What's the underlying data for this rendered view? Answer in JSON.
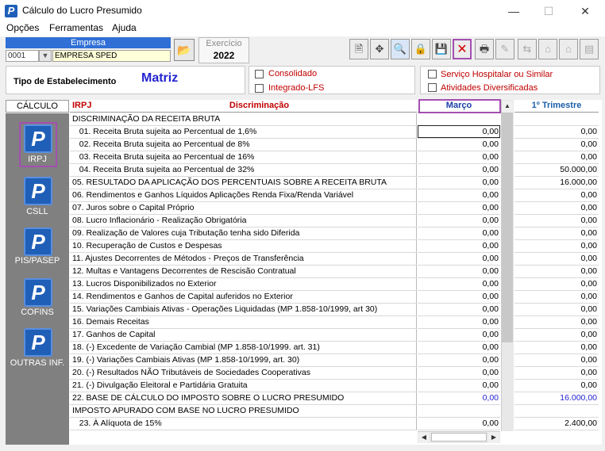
{
  "window": {
    "title": "Cálculo do Lucro Presumido",
    "controls": [
      "—",
      "☐",
      "✕"
    ]
  },
  "menu": [
    "Opções",
    "Ferramentas",
    "Ajuda"
  ],
  "empresa": {
    "header": "Empresa",
    "code": "0001",
    "name": "EMPRESA SPED"
  },
  "exercicio": {
    "label": "Exercício",
    "value": "2022"
  },
  "estabelecimento": {
    "label": "Tipo de Estabelecimento",
    "value": "Matriz"
  },
  "options": {
    "consolidado": "Consolidado",
    "integrado": "Integrado-LFS",
    "hospitalar": "Serviço Hospitalar ou Similar",
    "diversificadas": "Atividades Diversificadas"
  },
  "left_panel": {
    "header": "CÁLCULO",
    "items": [
      "IRPJ",
      "CSLL",
      "PIS/PASEP",
      "COFINS",
      "OUTRAS INF."
    ]
  },
  "grid": {
    "col_tax": "IRPJ",
    "col_desc": "Discriminação",
    "col_month": "Março",
    "col_quarter": "1º Trimestre",
    "rows": [
      {
        "d": "DISCRIMINAÇÃO DA RECEITA BRUTA",
        "m": "",
        "q": ""
      },
      {
        "d": "   01. Receita Bruta sujeita ao Percentual de 1,6%",
        "m": "0,00",
        "q": "0,00"
      },
      {
        "d": "   02. Receita Bruta sujeita ao Percentual de 8%",
        "m": "0,00",
        "q": "0,00"
      },
      {
        "d": "   03. Receita Bruta sujeita ao Percentual de 16%",
        "m": "0,00",
        "q": "0,00"
      },
      {
        "d": "   04. Receita Bruta sujeita ao Percentual de 32%",
        "m": "0,00",
        "q": "50.000,00"
      },
      {
        "d": "05. RESULTADO DA APLICAÇÃO DOS PERCENTUAIS SOBRE A RECEITA BRUTA",
        "m": "0,00",
        "q": "16.000,00"
      },
      {
        "d": "06. Rendimentos e Ganhos Líquidos Aplicações Renda Fixa/Renda Variável",
        "m": "0,00",
        "q": "0,00"
      },
      {
        "d": "07. Juros sobre o Capital Próprio",
        "m": "0,00",
        "q": "0,00"
      },
      {
        "d": "08. Lucro Inflacionário - Realização Obrigatória",
        "m": "0,00",
        "q": "0,00"
      },
      {
        "d": "09. Realização de Valores cuja Tributação tenha sido Diferida",
        "m": "0,00",
        "q": "0,00"
      },
      {
        "d": "10. Recuperação de Custos e Despesas",
        "m": "0,00",
        "q": "0,00"
      },
      {
        "d": "11. Ajustes Decorrentes de Métodos - Preços de Transferência",
        "m": "0,00",
        "q": "0,00"
      },
      {
        "d": "12. Multas e Vantagens Decorrentes de Rescisão Contratual",
        "m": "0,00",
        "q": "0,00"
      },
      {
        "d": "13. Lucros Disponibilizados no Exterior",
        "m": "0,00",
        "q": "0,00"
      },
      {
        "d": "14. Rendimentos e Ganhos de Capital auferidos no Exterior",
        "m": "0,00",
        "q": "0,00"
      },
      {
        "d": "15. Variações Cambiais Ativas - Operações Liquidadas (MP 1.858-10/1999, art 30)",
        "m": "0,00",
        "q": "0,00"
      },
      {
        "d": "16. Demais Receitas",
        "m": "0,00",
        "q": "0,00"
      },
      {
        "d": "17. Ganhos de Capital",
        "m": "0,00",
        "q": "0,00"
      },
      {
        "d": "18. (-) Excedente de Variação Cambial (MP 1.858-10/1999. art. 31)",
        "m": "0,00",
        "q": "0,00"
      },
      {
        "d": "19. (-) Variações Cambiais Ativas (MP 1.858-10/1999, art. 30)",
        "m": "0,00",
        "q": "0,00"
      },
      {
        "d": "20. (-) Resultados NÃO Tributáveis de Sociedades Cooperativas",
        "m": "0,00",
        "q": "0,00"
      },
      {
        "d": "21. (-) Divulgação Eleitoral e Partidária Gratuita",
        "m": "0,00",
        "q": "0,00"
      },
      {
        "d": "22. BASE DE CÁLCULO DO IMPOSTO SOBRE O LUCRO PRESUMIDO",
        "m": "0,00",
        "q": "16.000,00",
        "blue": true
      },
      {
        "d": "IMPOSTO APURADO COM BASE NO LUCRO PRESUMIDO",
        "m": "",
        "q": ""
      },
      {
        "d": "   23. À Alíquota de 15%",
        "m": "0,00",
        "q": "2.400,00"
      }
    ]
  },
  "colors": {
    "accent": "#2f6fd6",
    "highlight": "#a34fb0",
    "red_label": "#c00000",
    "blue_value": "#2424d0"
  }
}
